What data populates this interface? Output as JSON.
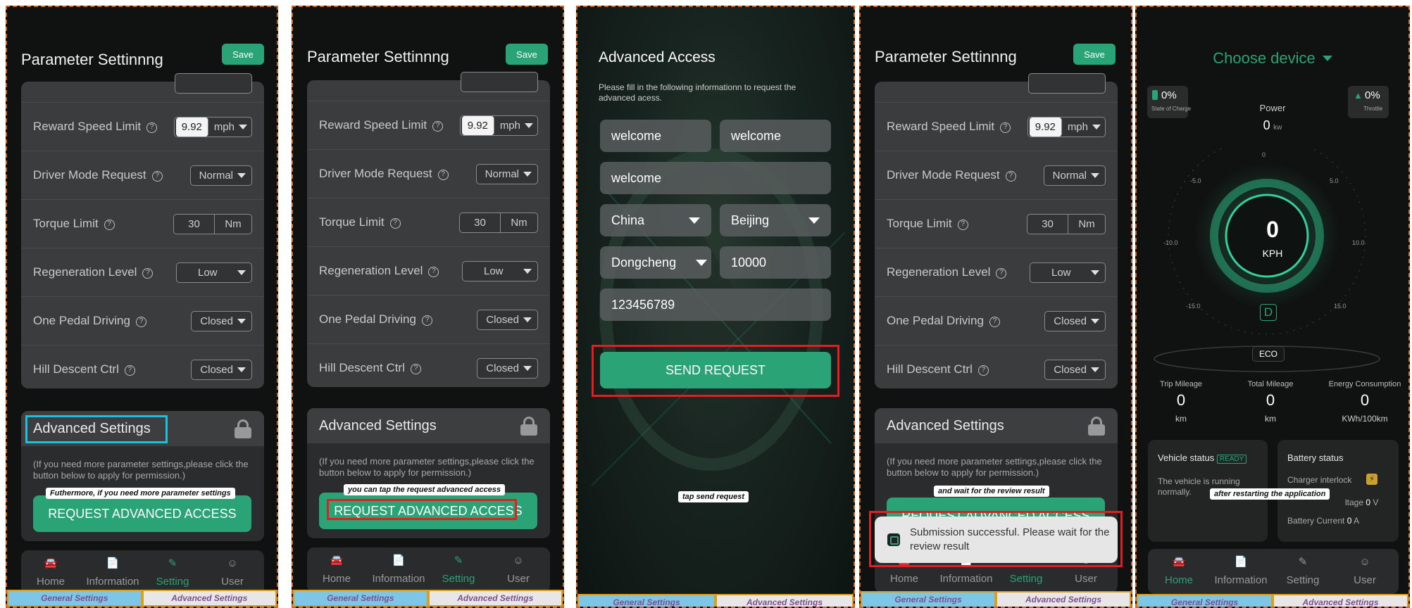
{
  "common": {
    "page_title": "Parameter Settinnng",
    "save_label": "Save",
    "params": [
      {
        "label": "Reward Speed Limit",
        "value": "9.92",
        "unit": "mph"
      },
      {
        "label": "Driver Mode Request",
        "value": "Normal"
      },
      {
        "label": "Torque Limit",
        "value": "30",
        "unit": "Nm"
      },
      {
        "label": "Regeneration Level",
        "value": "Low"
      },
      {
        "label": "One Pedal Driving",
        "value": "Closed"
      },
      {
        "label": "Hill Descent Ctrl",
        "value": "Closed"
      }
    ],
    "advanced_title": "Advanced Settings",
    "advanced_desc": "(If you need more parameter settings,please click the button below to apply for permission.)",
    "request_button": "REQUEST ADVANCED ACCESS",
    "nav": {
      "home": "Home",
      "information": "Information",
      "setting": "Setting",
      "user": "User"
    },
    "tag_general": "General Settings",
    "tag_advanced": "Advanced Settings"
  },
  "panel1": {
    "tip": "Futhermore, if you need more parameter settings"
  },
  "panel2": {
    "tip": "you can tap the request advanced access"
  },
  "panel3": {
    "title": "Advanced Access",
    "desc": "Please fill in the following informationn to request the advanced acess.",
    "first_name": "welcome",
    "last_name": "welcome",
    "company": "welcome",
    "country": "China",
    "city": "Beijing",
    "district": "Dongcheng",
    "postcode": "10000",
    "phone": "123456789",
    "send_button": "SEND REQUEST",
    "tip": "tap send request"
  },
  "panel4": {
    "tip": "and wait for the review result",
    "toast": "Submission successful. Please wait for the review result"
  },
  "panel5": {
    "device_label": "Choose device",
    "soc_value": "0%",
    "soc_label": "State of Charge",
    "power_label": "Power",
    "power_value": "0",
    "power_unit": "kw",
    "throttle_value": "0%",
    "throttle_label": "Throttle",
    "speed_value": "0",
    "speed_unit": "KPH",
    "gear": "D",
    "mode": "ECO",
    "ticks": [
      "0",
      "5.0",
      "-5.0",
      "10.0",
      "-10.0",
      "15.0",
      "-15.0"
    ],
    "trip_label": "Trip Mileage",
    "trip_value": "0",
    "trip_unit": "km",
    "total_label": "Total Mileage",
    "total_value": "0",
    "total_unit": "km",
    "energy_label": "Energy Consumption",
    "energy_value": "0",
    "energy_unit": "KWh/100km",
    "vehicle_status_label": "Vehicle status",
    "vehicle_status_badge": "READY",
    "vehicle_status_text": "The vehicle is running normally.",
    "battery_status_label": "Battery status",
    "charger_interlock": "Charger interlock",
    "voltage_label": "ltage",
    "voltage_value": "0",
    "voltage_unit": "V",
    "current_label": "Battery Current",
    "current_value": "0",
    "current_unit": "A",
    "tip": "after restarting the application"
  },
  "colors": {
    "accent": "#2aa376",
    "highlight_red": "#e02020",
    "highlight_cyan": "#1ec0e0"
  }
}
